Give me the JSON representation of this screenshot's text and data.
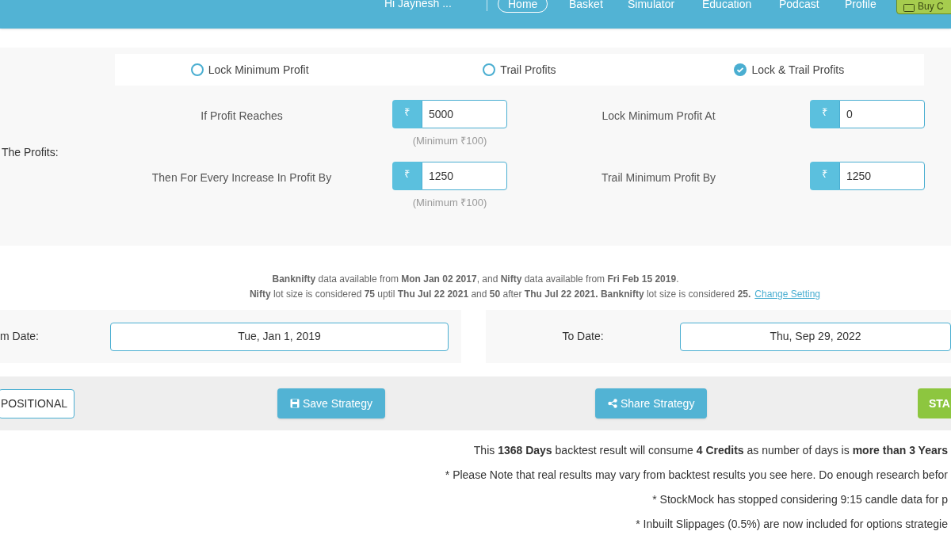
{
  "nav": {
    "greeting": "Hi Jaynesh ...",
    "links": [
      {
        "label": "Home",
        "selected": true
      },
      {
        "label": "Basket",
        "selected": false
      },
      {
        "label": "Simulator",
        "selected": false
      },
      {
        "label": "Education",
        "selected": false
      },
      {
        "label": "Podcast",
        "selected": false
      },
      {
        "label": "Profile",
        "selected": false
      }
    ],
    "buy_button": "Buy C"
  },
  "profit_section": {
    "label": "The Profits:",
    "options": [
      {
        "label": "Lock Minimum Profit",
        "selected": false
      },
      {
        "label": "Trail Profits",
        "selected": false
      },
      {
        "label": "Lock & Trail Profits",
        "selected": true
      }
    ],
    "rows": [
      {
        "label": "If Profit Reaches",
        "currency": "₹",
        "value": "5000",
        "hint": "(Minimum ₹100)",
        "right_label": "Lock Minimum Profit At",
        "right_currency": "₹",
        "right_value": "0"
      },
      {
        "label": "Then For Every Increase In Profit By",
        "currency": "₹",
        "value": "1250",
        "hint": "(Minimum ₹100)",
        "right_label": "Trail Minimum Profit By",
        "right_currency": "₹",
        "right_value": "1250"
      }
    ]
  },
  "info": {
    "line_1": "**Banknifty** data available from **Mon Jan 02 2017**, and **Nifty** data available from **Fri Feb 15 2019**.",
    "line_2": "**Nifty** lot size is considered **75** uptil **Thu Jul 22 2021** and **50** after **Thu Jul 22 2021. Banknifty** lot size is considered **25.**",
    "link": "Change Setting"
  },
  "dates": {
    "from_label": "m Date:",
    "from_value": "Tue, Jan 1, 2019",
    "to_label": "To Date:",
    "to_value": "Thu, Sep 29, 2022"
  },
  "actions": {
    "mode": "POSITIONAL",
    "save": "Save Strategy",
    "share": "Share Strategy",
    "start": "STA"
  },
  "notes": [
    "This **1368 Days** backtest result will consume **4 Credits** as number of days is **more than 3 Years**",
    "* Please Note that real results may vary from backtest results you see here. Do enough research befor",
    "* StockMock has stopped considering 9:15 candle data for p",
    "* Inbuilt Slippages (0.5%) are now included for options strategie"
  ]
}
